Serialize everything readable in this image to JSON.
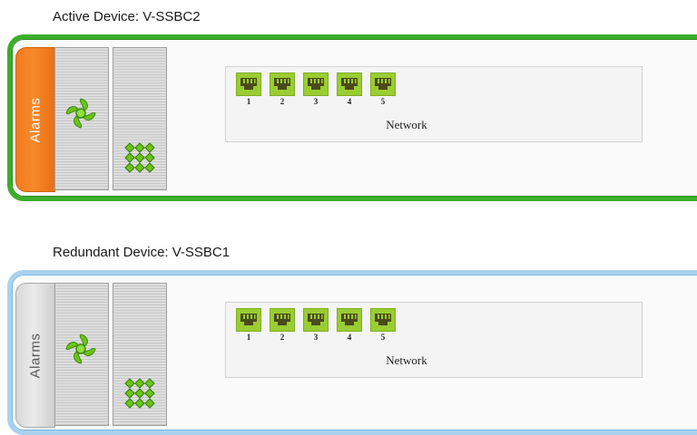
{
  "devices": [
    {
      "title": "Active Device: V-SSBC2",
      "status": "active",
      "alarms_label": "Alarms",
      "network": {
        "label": "Network",
        "ports": [
          {
            "number": "1"
          },
          {
            "number": "2"
          },
          {
            "number": "3"
          },
          {
            "number": "4"
          },
          {
            "number": "5"
          }
        ]
      }
    },
    {
      "title": "Redundant Device: V-SSBC1",
      "status": "redundant",
      "alarms_label": "Alarms",
      "network": {
        "label": "Network",
        "ports": [
          {
            "number": "1"
          },
          {
            "number": "2"
          },
          {
            "number": "3"
          },
          {
            "number": "4"
          },
          {
            "number": "5"
          }
        ]
      }
    }
  ],
  "colors": {
    "active_border": "#3cae2a",
    "redundant_border": "#a8d2ee",
    "alarm_active": "#f37a1c",
    "alarm_inactive": "#d9d9d9",
    "port_green": "#9acd32",
    "icon_green": "#6cc417"
  },
  "icons": {
    "fan": "fan-icon",
    "module_grid": "module-grid-icon",
    "ethernet_port": "ethernet-port-icon"
  }
}
